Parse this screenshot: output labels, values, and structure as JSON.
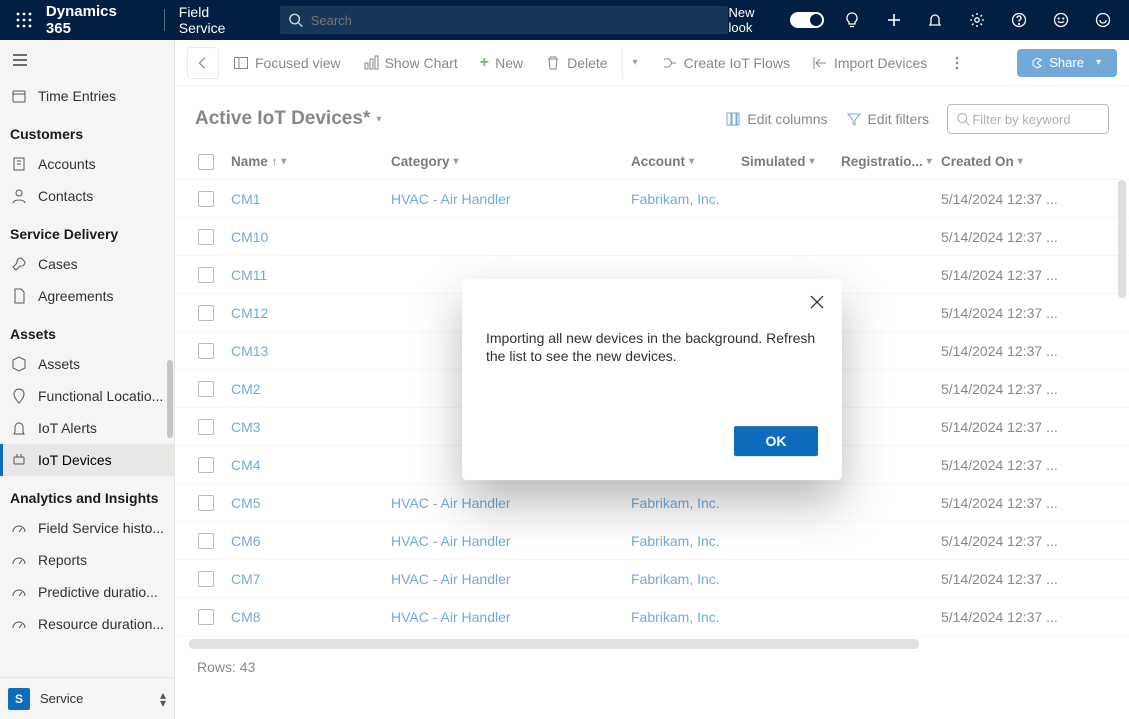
{
  "suite": {
    "brand": "Dynamics 365",
    "app": "Field Service",
    "search_placeholder": "Search",
    "newlook_label": "New look"
  },
  "sidebar": {
    "top_item": "Time Entries",
    "sections": [
      {
        "title": "Customers",
        "items": [
          "Accounts",
          "Contacts"
        ]
      },
      {
        "title": "Service Delivery",
        "items": [
          "Cases",
          "Agreements"
        ]
      },
      {
        "title": "Assets",
        "items": [
          "Assets",
          "Functional Locatio...",
          "IoT Alerts",
          "IoT Devices"
        ]
      },
      {
        "title": "Analytics and Insights",
        "items": [
          "Field Service histo...",
          "Reports",
          "Predictive duratio...",
          "Resource duration..."
        ]
      }
    ],
    "active_item": "IoT Devices",
    "switcher": {
      "initial": "S",
      "label": "Service"
    }
  },
  "cmdbar": {
    "focused_view": "Focused view",
    "show_chart": "Show Chart",
    "new": "New",
    "delete": "Delete",
    "create_flows": "Create IoT Flows",
    "import_devices": "Import Devices",
    "share": "Share"
  },
  "view": {
    "title": "Active IoT Devices*",
    "edit_columns": "Edit columns",
    "edit_filters": "Edit filters",
    "filter_placeholder": "Filter by keyword"
  },
  "grid": {
    "columns": [
      "Name",
      "Category",
      "Account",
      "Simulated",
      "Registratio...",
      "Created On"
    ],
    "rows": [
      {
        "name": "CM1",
        "category": "HVAC - Air Handler",
        "account": "Fabrikam, Inc.",
        "created": "5/14/2024 12:37 ..."
      },
      {
        "name": "CM10",
        "category": "",
        "account": "",
        "created": "5/14/2024 12:37 ..."
      },
      {
        "name": "CM11",
        "category": "",
        "account": "",
        "created": "5/14/2024 12:37 ..."
      },
      {
        "name": "CM12",
        "category": "",
        "account": "",
        "created": "5/14/2024 12:37 ..."
      },
      {
        "name": "CM13",
        "category": "",
        "account": "",
        "created": "5/14/2024 12:37 ..."
      },
      {
        "name": "CM2",
        "category": "",
        "account": "",
        "created": "5/14/2024 12:37 ..."
      },
      {
        "name": "CM3",
        "category": "",
        "account": "",
        "created": "5/14/2024 12:37 ..."
      },
      {
        "name": "CM4",
        "category": "",
        "account": "",
        "created": "5/14/2024 12:37 ..."
      },
      {
        "name": "CM5",
        "category": "HVAC - Air Handler",
        "account": "Fabrikam, Inc.",
        "created": "5/14/2024 12:37 ..."
      },
      {
        "name": "CM6",
        "category": "HVAC - Air Handler",
        "account": "Fabrikam, Inc.",
        "created": "5/14/2024 12:37 ..."
      },
      {
        "name": "CM7",
        "category": "HVAC - Air Handler",
        "account": "Fabrikam, Inc.",
        "created": "5/14/2024 12:37 ..."
      },
      {
        "name": "CM8",
        "category": "HVAC - Air Handler",
        "account": "Fabrikam, Inc.",
        "created": "5/14/2024 12:37 ..."
      }
    ],
    "footer": "Rows: 43"
  },
  "dialog": {
    "message": "Importing all new devices in the background. Refresh the list to see the new devices.",
    "ok": "OK"
  }
}
